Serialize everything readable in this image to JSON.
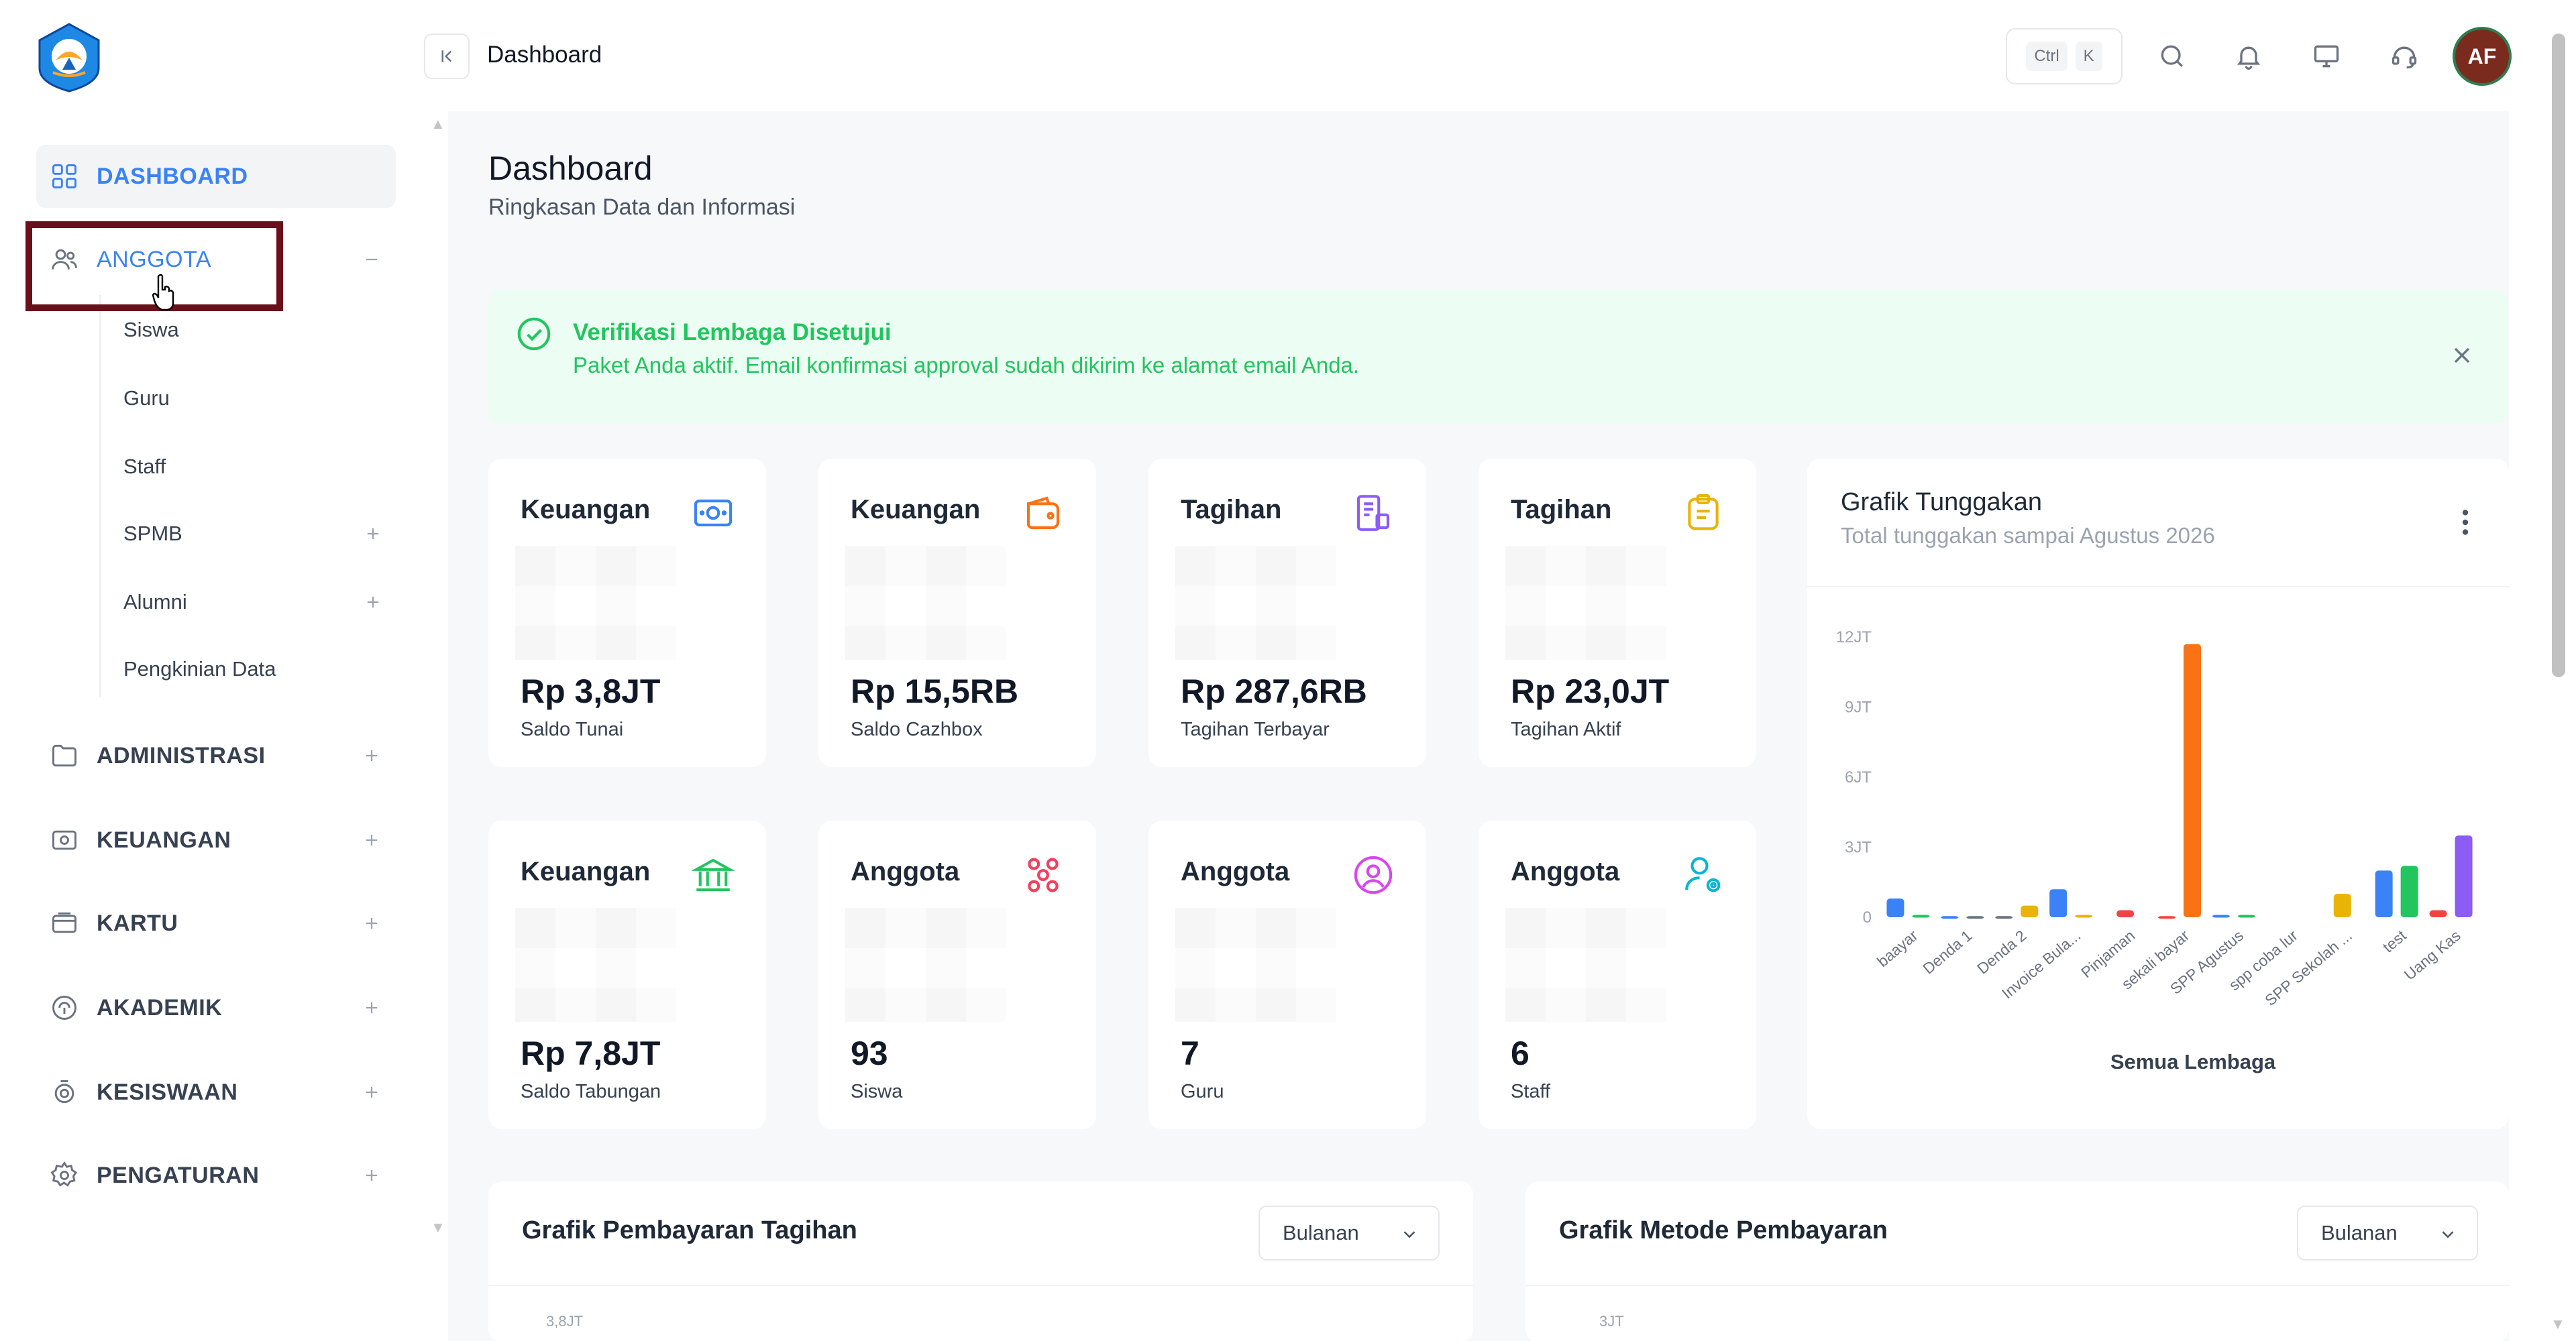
{
  "sidebar": {
    "nav": {
      "dashboard": "DASHBOARD",
      "anggota": "ANGGOTA",
      "administrasi": "ADMINISTRASI",
      "keuangan": "KEUANGAN",
      "kartu": "KARTU",
      "akademik": "AKADEMIK",
      "kesiswaan": "KESISWAAN",
      "pengaturan": "PENGATURAN"
    },
    "anggota_sub": [
      "Siswa",
      "Guru",
      "Staff",
      "SPMB",
      "Alumni",
      "Pengkinian Data"
    ]
  },
  "topbar": {
    "title": "Dashboard",
    "kbd_ctrl": "Ctrl",
    "kbd_k": "K",
    "avatar_initials": "AF"
  },
  "page": {
    "title": "Dashboard",
    "subtitle": "Ringkasan Data dan Informasi"
  },
  "alert": {
    "title": "Verifikasi Lembaga Disetujui",
    "text": "Paket Anda aktif. Email konfirmasi approval sudah dikirim ke alamat email Anda."
  },
  "cards": [
    {
      "title": "Keuangan",
      "value": "Rp 3,8JT",
      "label": "Saldo Tunai",
      "icon": "cash-icon",
      "color": "#3b82f6"
    },
    {
      "title": "Keuangan",
      "value": "Rp 15,5RB",
      "label": "Saldo Cazhbox",
      "icon": "wallet-icon",
      "color": "#f97316"
    },
    {
      "title": "Tagihan",
      "value": "Rp 287,6RB",
      "label": "Tagihan Terbayar",
      "icon": "receipt-icon",
      "color": "#8b5cf6"
    },
    {
      "title": "Tagihan",
      "value": "Rp 23,0JT",
      "label": "Tagihan Aktif",
      "icon": "clipboard-icon",
      "color": "#eab308"
    },
    {
      "title": "Keuangan",
      "value": "Rp 7,8JT",
      "label": "Saldo Tabungan",
      "icon": "bank-icon",
      "color": "#22c55e"
    },
    {
      "title": "Anggota",
      "value": "93",
      "label": "Siswa",
      "icon": "users-group-icon",
      "color": "#f43f5e"
    },
    {
      "title": "Anggota",
      "value": "7",
      "label": "Guru",
      "icon": "user-circle-icon",
      "color": "#d946ef"
    },
    {
      "title": "Anggota",
      "value": "6",
      "label": "Staff",
      "icon": "user-settings-icon",
      "color": "#06b6d4"
    }
  ],
  "tunggakan": {
    "title": "Grafik Tunggakan",
    "subtitle": "Total tunggakan sampai Agustus 2026"
  },
  "chart_data": {
    "type": "bar",
    "xlabel": "Semua Lembaga",
    "ylabel": "",
    "ylim": [
      0,
      12
    ],
    "yticks": [
      "0",
      "3JT",
      "6JT",
      "9JT",
      "12JT"
    ],
    "grid": false,
    "categories": [
      "baayar",
      "Denda 1",
      "Denda 2",
      "Invoice Bula...",
      "Pinjaman",
      "sekali bayar",
      "SPP Agustus",
      "spp coba lur",
      "SPP Sekolah ...",
      "test",
      "Uang Kas"
    ],
    "series": [
      {
        "color": "#3b82f6",
        "values": [
          0.8,
          0.05,
          0,
          1.2,
          0,
          0,
          0.1,
          0,
          0,
          2.0,
          0
        ]
      },
      {
        "color": "#22c55e",
        "values": [
          0.1,
          0,
          0,
          0,
          0,
          0,
          0.1,
          0,
          0,
          2.2,
          0
        ]
      },
      {
        "color": "#6b7280",
        "values": [
          0,
          0.05,
          0.05,
          0,
          0,
          0,
          0,
          0,
          0,
          0,
          0
        ]
      },
      {
        "color": "#eab308",
        "values": [
          0,
          0,
          0.5,
          0.1,
          0,
          0,
          0,
          0,
          1.0,
          0,
          0
        ]
      },
      {
        "color": "#ef4444",
        "values": [
          0,
          0,
          0,
          0,
          0.3,
          0.05,
          0,
          0,
          0,
          0,
          0.3
        ]
      },
      {
        "color": "#f97316",
        "values": [
          0,
          0,
          0,
          0,
          0,
          11.7,
          0,
          0,
          0,
          0,
          0
        ]
      },
      {
        "color": "#8b5cf6",
        "values": [
          0,
          0,
          0,
          0,
          0,
          0,
          0,
          0,
          0,
          0,
          3.5
        ]
      }
    ]
  },
  "bottom": {
    "pembayaran_title": "Grafik Pembayaran Tagihan",
    "pembayaran_select": "Bulanan",
    "pembayaran_tick": "3,8JT",
    "metode_title": "Grafik Metode Pembayaran",
    "metode_select": "Bulanan",
    "metode_tick": "3JT"
  }
}
